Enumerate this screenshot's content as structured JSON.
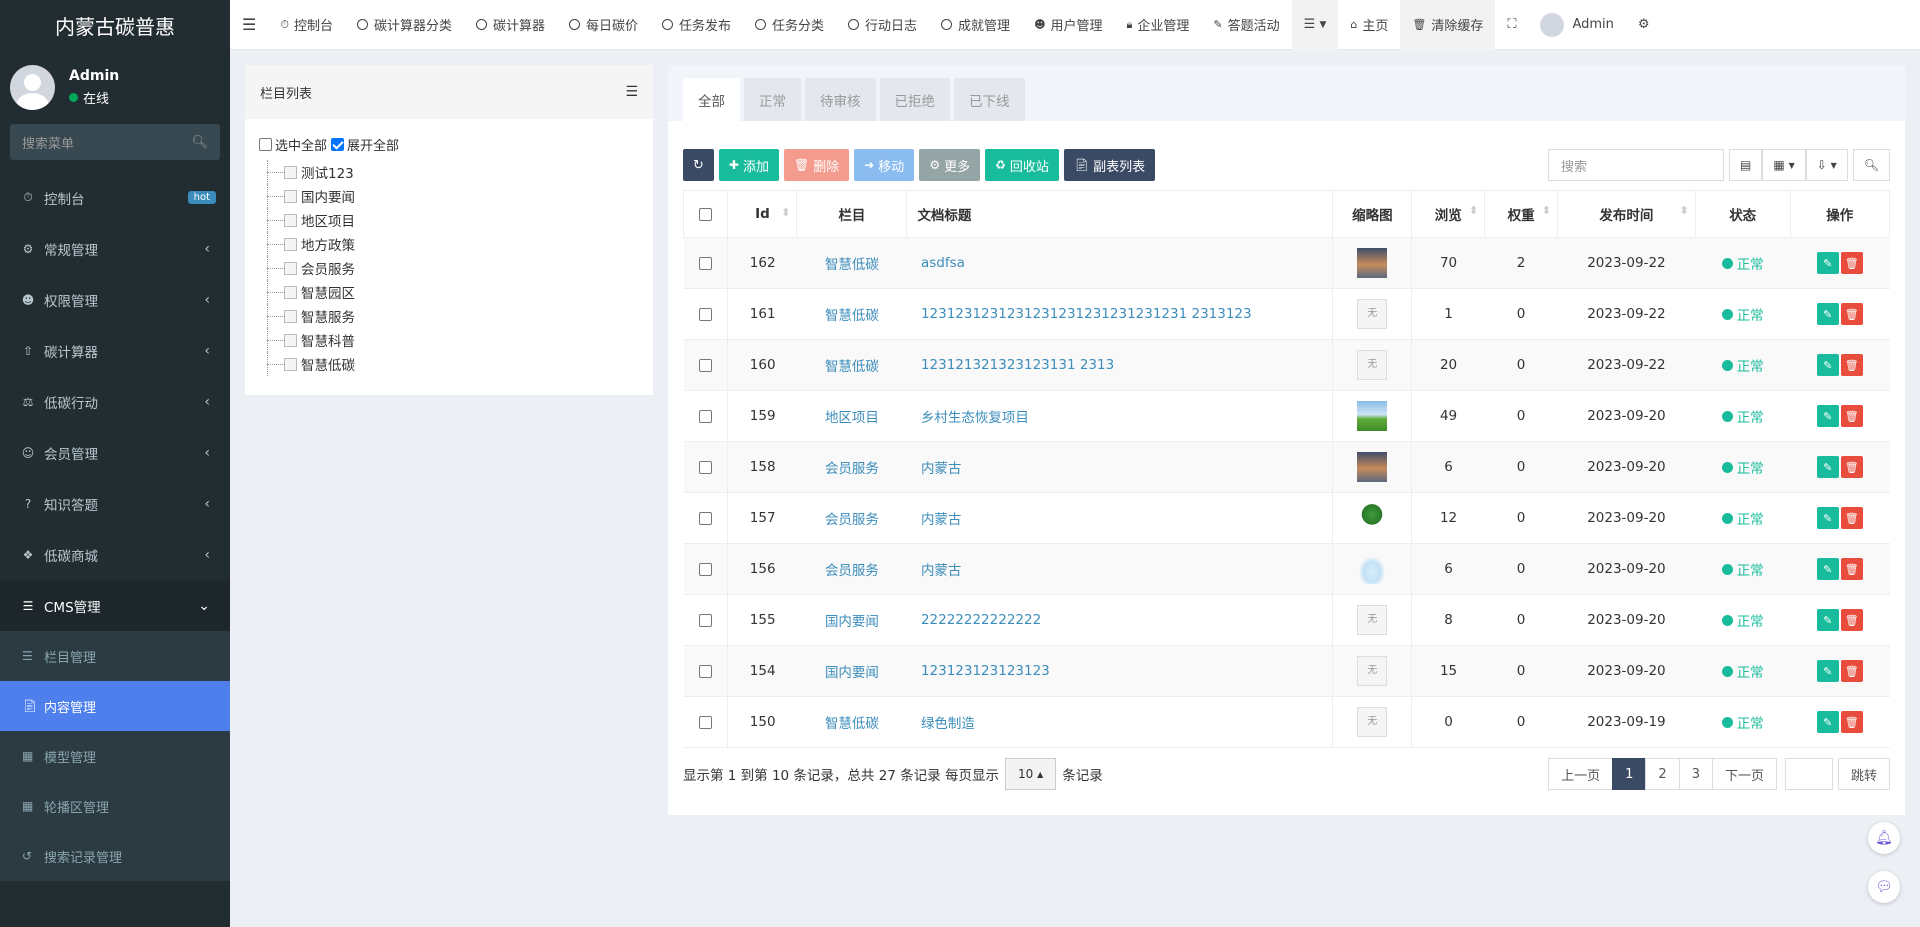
{
  "brand": "内蒙古碳普惠",
  "user": {
    "name": "Admin",
    "status": "在线"
  },
  "sidebar": {
    "search_placeholder": "搜索菜单",
    "items": [
      {
        "label": "控制台",
        "icon": "dashboard-icon",
        "badge": "hot"
      },
      {
        "label": "常规管理",
        "icon": "cogs-icon"
      },
      {
        "label": "权限管理",
        "icon": "group-icon"
      },
      {
        "label": "碳计算器",
        "icon": "arrow-circle-up-icon"
      },
      {
        "label": "低碳行动",
        "icon": "balance-scale-icon"
      },
      {
        "label": "会员管理",
        "icon": "user-circle-icon"
      },
      {
        "label": "知识答题",
        "icon": "question-circle-icon"
      },
      {
        "label": "低碳商城",
        "icon": "dropbox-icon"
      },
      {
        "label": "CMS管理",
        "icon": "list-icon"
      }
    ],
    "cms_sub": [
      {
        "label": "栏目管理",
        "icon": "list-icon"
      },
      {
        "label": "内容管理",
        "icon": "file-icon"
      },
      {
        "label": "模型管理",
        "icon": "th-icon"
      },
      {
        "label": "轮播区管理",
        "icon": "th-large-icon"
      },
      {
        "label": "搜索记录管理",
        "icon": "history-icon"
      }
    ]
  },
  "topnav": {
    "items": [
      "控制台",
      "碳计算器分类",
      "碳计算器",
      "每日碳价",
      "任务发布",
      "任务分类",
      "行动日志",
      "成就管理",
      "用户管理",
      "企业管理",
      "答题活动"
    ],
    "home": "主页",
    "clear_cache": "清除缓存",
    "admin": "Admin"
  },
  "category_panel": {
    "title": "栏目列表",
    "select_all": "选中全部",
    "expand_all": "展开全部",
    "nodes": [
      "测试123",
      "国内要闻",
      "地区项目",
      "地方政策",
      "会员服务",
      "智慧园区",
      "智慧服务",
      "智慧科普",
      "智慧低碳"
    ]
  },
  "tabs": [
    "全部",
    "正常",
    "待审核",
    "已拒绝",
    "已下线"
  ],
  "toolbar": {
    "add": "添加",
    "delete": "删除",
    "move": "移动",
    "more": "更多",
    "recycle": "回收站",
    "sub_list": "副表列表",
    "search_placeholder": "搜索"
  },
  "table": {
    "headers": [
      "Id",
      "栏目",
      "文档标题",
      "缩略图",
      "浏览",
      "权重",
      "发布时间",
      "状态",
      "操作"
    ],
    "no_thumb": "无",
    "rows": [
      {
        "id": "162",
        "cat": "智慧低碳",
        "title": "asdfsa",
        "thumb": "sunset",
        "views": "70",
        "weight": "2",
        "date": "2023-09-22",
        "status": "正常"
      },
      {
        "id": "161",
        "cat": "智慧低碳",
        "title": "1231231231231231231231231231231 2313123",
        "thumb": "none",
        "views": "1",
        "weight": "0",
        "date": "2023-09-22",
        "status": "正常"
      },
      {
        "id": "160",
        "cat": "智慧低碳",
        "title": "123121321323123131 2313",
        "thumb": "none",
        "views": "20",
        "weight": "0",
        "date": "2023-09-22",
        "status": "正常"
      },
      {
        "id": "159",
        "cat": "地区项目",
        "title": "乡村生态恢复项目",
        "thumb": "field",
        "views": "49",
        "weight": "0",
        "date": "2023-09-20",
        "status": "正常"
      },
      {
        "id": "158",
        "cat": "会员服务",
        "title": "内蒙古",
        "thumb": "sunset",
        "views": "6",
        "weight": "0",
        "date": "2023-09-20",
        "status": "正常"
      },
      {
        "id": "157",
        "cat": "会员服务",
        "title": "内蒙古",
        "thumb": "tree-img",
        "views": "12",
        "weight": "0",
        "date": "2023-09-20",
        "status": "正常"
      },
      {
        "id": "156",
        "cat": "会员服务",
        "title": "内蒙古",
        "thumb": "cloud",
        "views": "6",
        "weight": "0",
        "date": "2023-09-20",
        "status": "正常"
      },
      {
        "id": "155",
        "cat": "国内要闻",
        "title": "22222222222222",
        "thumb": "none",
        "views": "8",
        "weight": "0",
        "date": "2023-09-20",
        "status": "正常"
      },
      {
        "id": "154",
        "cat": "国内要闻",
        "title": "123123123123123",
        "thumb": "none",
        "views": "15",
        "weight": "0",
        "date": "2023-09-20",
        "status": "正常"
      },
      {
        "id": "150",
        "cat": "智慧低碳",
        "title": "绿色制造",
        "thumb": "none",
        "views": "0",
        "weight": "0",
        "date": "2023-09-19",
        "status": "正常"
      }
    ]
  },
  "pagination": {
    "info_prefix": "显示第 1 到第 10 条记录，总共 27 条记录 每页显示",
    "page_size": "10",
    "info_suffix": "条记录",
    "prev": "上一页",
    "pages": [
      "1",
      "2",
      "3"
    ],
    "current": "1",
    "next": "下一页",
    "jump": "跳转"
  },
  "colors": {
    "sidebar_bg": "#222d32",
    "active": "#4e7fed",
    "success": "#18bc9c",
    "danger": "#e74c3c",
    "dark_btn": "#3b4a64"
  }
}
